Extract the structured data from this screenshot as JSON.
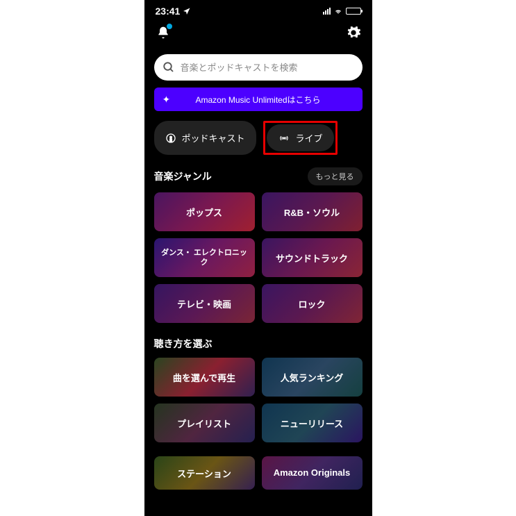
{
  "status": {
    "time": "23:41"
  },
  "search": {
    "placeholder": "音楽とポッドキャストを検索"
  },
  "banner": {
    "text": "Amazon Music Unlimitedはこちら"
  },
  "pills": {
    "podcast": "ポッドキャスト",
    "live": "ライブ"
  },
  "section1": {
    "title": "音楽ジャンル",
    "more": "もっと見る",
    "tiles": {
      "pops": "ポップス",
      "rbsoul": "R&B・ソウル",
      "dance": "ダンス・ エレクトロニック",
      "soundtrack": "サウンドトラック",
      "tv": "テレビ・映画",
      "rock": "ロック"
    }
  },
  "section2": {
    "title": "聴き方を選ぶ",
    "tiles": {
      "songs": "曲を選んで再生",
      "ranking": "人気ランキング",
      "playlist": "プレイリスト",
      "newrelease": "ニューリリース",
      "station": "ステーション",
      "originals": "Amazon Originals"
    }
  }
}
